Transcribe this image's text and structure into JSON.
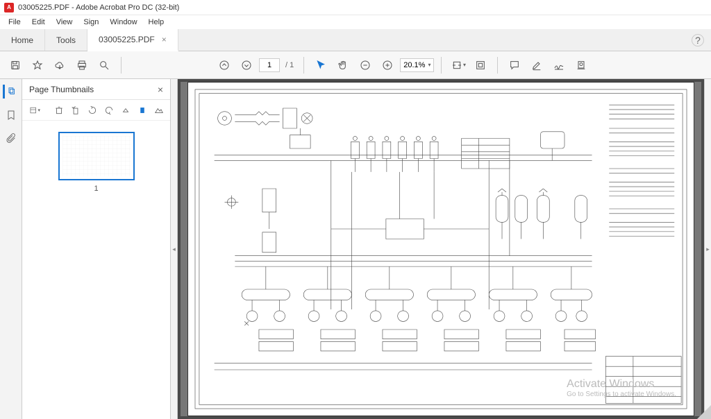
{
  "app": {
    "title": "03005225.PDF - Adobe Acrobat Pro DC (32-bit)",
    "icon_letter": "A"
  },
  "menu": {
    "items": [
      "File",
      "Edit",
      "View",
      "Sign",
      "Window",
      "Help"
    ]
  },
  "tabs": {
    "home": "Home",
    "tools": "Tools",
    "docs": [
      {
        "label": "03005225.PDF",
        "active": true
      }
    ]
  },
  "toolbar": {
    "page_current": "1",
    "page_total": "/ 1",
    "zoom": "20.1%"
  },
  "thumbnails": {
    "title": "Page Thumbnails",
    "pages": [
      {
        "num": "1"
      }
    ]
  },
  "watermark": {
    "line1": "Activate Windows",
    "line2": "Go to Settings to activate Windows."
  }
}
